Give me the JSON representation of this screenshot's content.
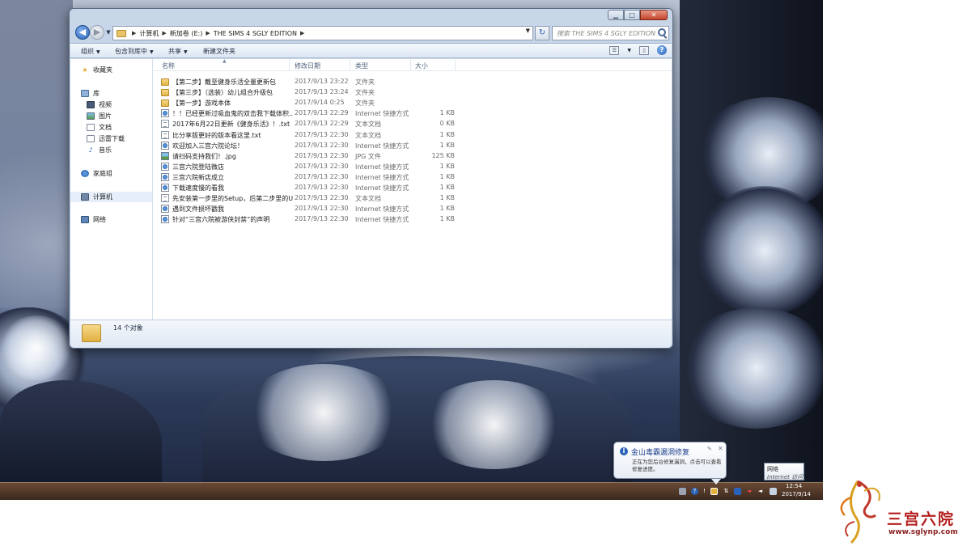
{
  "window": {
    "controls": {
      "minimize": "▁",
      "maximize": "□",
      "close": "✕"
    }
  },
  "address": {
    "crumbs": [
      "计算机",
      "新加卷 (E:)",
      "THE SIMS 4 SGLY EDITION"
    ],
    "search_placeholder": "搜索 THE SIMS 4 SGLY EDITION"
  },
  "toolbar": {
    "organize": "组织",
    "include_in_library": "包含到库中",
    "share": "共享",
    "new_folder": "新建文件夹"
  },
  "nav": {
    "favorites": "收藏夹",
    "libraries": "库",
    "videos": "视频",
    "pictures": "图片",
    "documents": "文档",
    "downloads": "迅雷下载",
    "music": "音乐",
    "homegroup": "家庭组",
    "computer": "计算机",
    "network": "网络"
  },
  "columns": {
    "name": "名称",
    "date": "修改日期",
    "type": "类型",
    "size": "大小"
  },
  "files": [
    {
      "icon": "folder",
      "name": "【第二步】戴至健身乐活全量更新包",
      "date": "2017/9/13 23:22",
      "type": "文件夹",
      "size": ""
    },
    {
      "icon": "folder",
      "name": "【第三步】（选装）幼儿组合升级包",
      "date": "2017/9/13 23:24",
      "type": "文件夹",
      "size": ""
    },
    {
      "icon": "folder",
      "name": "【第一步】游戏本体",
      "date": "2017/9/14 0:25",
      "type": "文件夹",
      "size": ""
    },
    {
      "icon": "link",
      "name": "！！已经更新过吸血鬼的双击我下载体积...",
      "date": "2017/9/13 22:29",
      "type": "Internet 快捷方式",
      "size": "1 KB"
    },
    {
      "icon": "txt",
      "name": "2017年6月22日更新《健身乐活》！.txt",
      "date": "2017/9/13 22:29",
      "type": "文本文档",
      "size": "0 KB"
    },
    {
      "icon": "txt",
      "name": "比分享版更好的版本看这里.txt",
      "date": "2017/9/13 22:30",
      "type": "文本文档",
      "size": "1 KB"
    },
    {
      "icon": "link",
      "name": "欢迎加入三宫六院论坛！",
      "date": "2017/9/13 22:30",
      "type": "Internet 快捷方式",
      "size": "1 KB"
    },
    {
      "icon": "jpg",
      "name": "请扫码支持我们！.jpg",
      "date": "2017/9/13 22:30",
      "type": "JPG 文件",
      "size": "125 KB"
    },
    {
      "icon": "link",
      "name": "三宫六院登陆微店",
      "date": "2017/9/13 22:30",
      "type": "Internet 快捷方式",
      "size": "1 KB"
    },
    {
      "icon": "link",
      "name": "三宫六院新店成立",
      "date": "2017/9/13 22:30",
      "type": "Internet 快捷方式",
      "size": "1 KB"
    },
    {
      "icon": "link",
      "name": "下载速度慢的看我",
      "date": "2017/9/13 22:30",
      "type": "Internet 快捷方式",
      "size": "1 KB"
    },
    {
      "icon": "txt",
      "name": "先安装第一步里的Setup，后第二步里的U...",
      "date": "2017/9/13 22:30",
      "type": "文本文档",
      "size": "1 KB"
    },
    {
      "icon": "link",
      "name": "遇到文件损坏戳我",
      "date": "2017/9/13 22:30",
      "type": "Internet 快捷方式",
      "size": "1 KB"
    },
    {
      "icon": "link",
      "name": "针对“三宫六院被游侠封禁”的声明",
      "date": "2017/9/13 22:30",
      "type": "Internet 快捷方式",
      "size": "1 KB"
    }
  ],
  "details": {
    "item_count": "14 个对象"
  },
  "balloon": {
    "title": "金山毒霸漏洞修复",
    "text": "正在为您后台修复漏洞，点击可以查看修复进度。"
  },
  "network_tip": {
    "title": "网络",
    "subtitle": "Internet 访问"
  },
  "clock": {
    "time": "12:54",
    "date": "2017/9/14"
  },
  "watermark": {
    "name": "三宫六院",
    "url": "www.sglynp.com"
  },
  "colors": {
    "accent": "#2a63b7",
    "folder": "#e9c46a",
    "logo_red": "#b3201f"
  }
}
